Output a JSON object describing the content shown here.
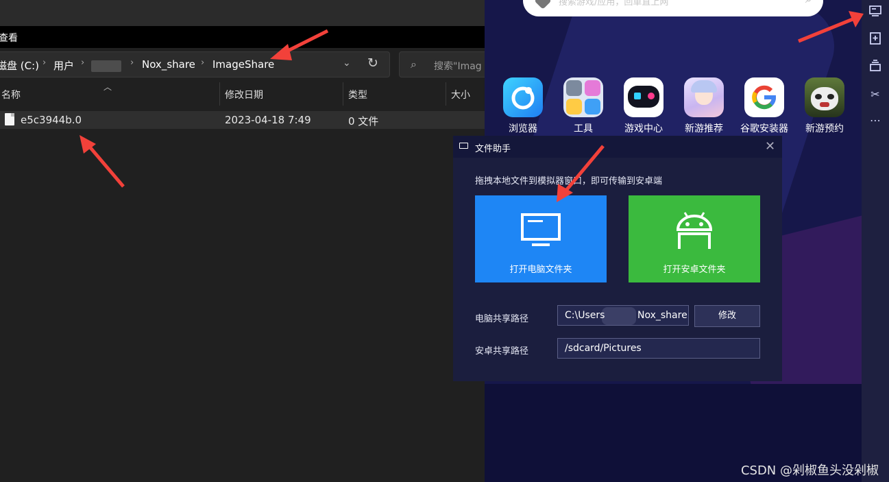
{
  "explorer": {
    "menubar": {
      "view_label": "查看"
    },
    "address": {
      "crumbs": [
        "磁盘 (C:)",
        "用户",
        "Nox_share",
        "ImageShare"
      ],
      "separator": "›"
    },
    "search": {
      "placeholder": "搜索\"Imag"
    },
    "columns": {
      "name": "名称",
      "date": "修改日期",
      "type": "类型",
      "size": "大小"
    },
    "files": [
      {
        "name": "e5c3944b.0",
        "date": "2023-04-18 7:49",
        "type": "0 文件"
      }
    ]
  },
  "emulator": {
    "search_placeholder": "搜索游戏/应用，回車直上网",
    "apps": [
      {
        "label": "浏览器",
        "icon": "browser-icon"
      },
      {
        "label": "工具",
        "icon": "tools-icon"
      },
      {
        "label": "游戏中心",
        "icon": "game-center-icon"
      },
      {
        "label": "新游推荐",
        "icon": "new-game-icon"
      },
      {
        "label": "谷歌安装器",
        "icon": "google-icon"
      },
      {
        "label": "新游预约",
        "icon": "reserve-icon"
      }
    ],
    "toolbar_icons": [
      "screen-icon",
      "apk-install-icon",
      "multi-instance-icon",
      "scissors-icon",
      "more-icon"
    ]
  },
  "dialog": {
    "title": "文件助手",
    "close": "✕",
    "description": "拖拽本地文件到模拟器窗口，即可传输到安卓端",
    "open_pc_folder": "打开电脑文件夹",
    "open_android_folder": "打开安卓文件夹",
    "pc_path_label": "电脑共享路径",
    "pc_path_start": "C:\\Users",
    "pc_path_end": "Nox_share",
    "modify_button": "修改",
    "android_path_label": "安卓共享路径",
    "android_path": "/sdcard/Pictures",
    "colors": {
      "pc_button": "#1e86f5",
      "android_button": "#3bba3e",
      "arrow": "#f2413a"
    }
  },
  "watermark": "CSDN @剁椒鱼头没剁椒"
}
